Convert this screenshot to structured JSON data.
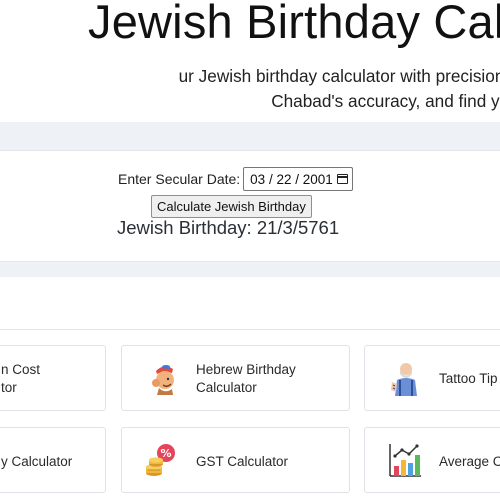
{
  "header": {
    "title": "Jewish Birthday Cal",
    "subtitle_line1": "ur Jewish birthday calculator with precision using online to",
    "subtitle_line2": "Chabad's accuracy, and find your Jewish birth"
  },
  "calculator": {
    "date_label": "Enter Secular Date:",
    "date_value": "03 / 22 / 2001",
    "button_label": "Calculate Jewish Birthday",
    "result": "Jewish Birthday: 21/3/5761"
  },
  "tiles": [
    {
      "line1": "n Cost",
      "line2": "tor",
      "icon": "none"
    },
    {
      "line1": "Hebrew Birthday",
      "line2": "Calculator",
      "icon": "person-icon"
    },
    {
      "line1": "Tattoo Tip",
      "line2": "",
      "icon": "tattoo-artist-icon"
    },
    {
      "line1": "y Calculator",
      "line2": "",
      "icon": "none"
    },
    {
      "line1": "GST Calculator",
      "line2": "",
      "icon": "percent-coins-icon"
    },
    {
      "line1": "Average C",
      "line2": "",
      "icon": "bar-chart-icon"
    }
  ],
  "colors": {
    "band_background": "#eef2f6",
    "tile_border": "#dfe2e6",
    "text": "#2a2a2a"
  }
}
